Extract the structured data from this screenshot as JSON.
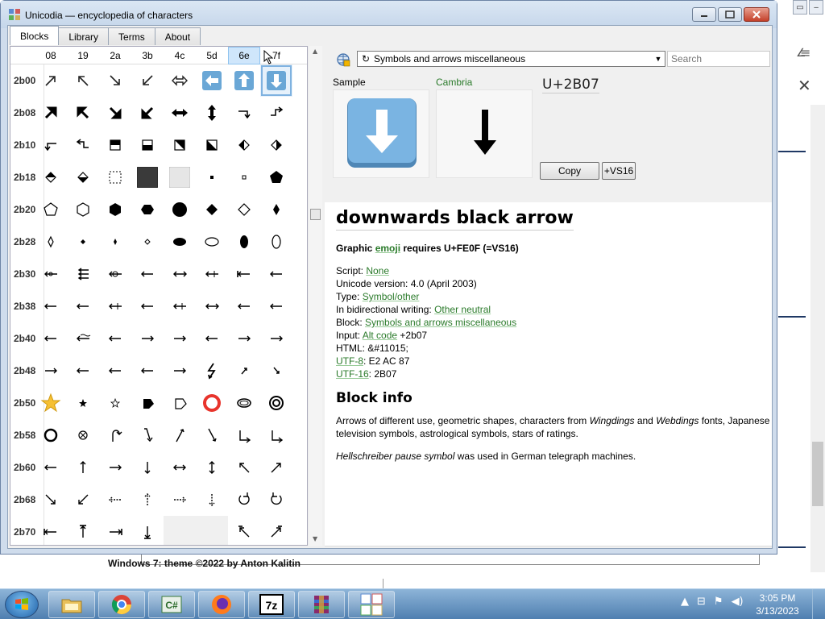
{
  "app": {
    "title": "Unicodia — encyclopedia of characters"
  },
  "tabs": [
    {
      "label": "Blocks",
      "active": true
    },
    {
      "label": "Library",
      "active": false
    },
    {
      "label": "Terms",
      "active": false
    },
    {
      "label": "About",
      "active": false
    }
  ],
  "grid": {
    "columns": [
      "08",
      "19",
      "2a",
      "3b",
      "4c",
      "5d",
      "6e",
      "7f"
    ],
    "highlighted_column": "6e",
    "selected_cell": {
      "row": "2b00",
      "col": 7
    },
    "rows": [
      {
        "label": "2b00",
        "cells": [
          "arrow-ne-outline",
          "arrow-nw-outline",
          "arrow-se-outline",
          "arrow-sw-outline",
          "arrow-lr-outline",
          "emoji-left",
          "emoji-up",
          "emoji-down"
        ]
      },
      {
        "label": "2b08",
        "cells": [
          "arrow-ne-black",
          "arrow-nw-black",
          "arrow-se-black",
          "arrow-sw-black",
          "arrow-lr-black",
          "arrow-ud-black",
          "arrow-corner-right",
          "arrow-up-right"
        ]
      },
      {
        "label": "2b10",
        "cells": [
          "arrow-corner-left",
          "arrow-up-left",
          "square-top-half",
          "square-bottom-half",
          "square-diag-ur",
          "square-diag-ll",
          "diamond-left-half",
          "diamond-right-half"
        ]
      },
      {
        "label": "2b18",
        "cells": [
          "diamond-top-half",
          "diamond-bottom-half",
          "dotted-square",
          "emoji-black-square",
          "emoji-white-square",
          "small-black-square",
          "small-white-square",
          "black-pentagon"
        ]
      },
      {
        "label": "2b20",
        "cells": [
          "white-pentagon",
          "white-hexagon",
          "black-hexagon",
          "black-horiz-hexagon",
          "black-circle",
          "black-diamond",
          "white-diamond",
          "black-narrow-diamond"
        ]
      },
      {
        "label": "2b28",
        "cells": [
          "white-narrow-diamond",
          "small-black-diamond",
          "small-narrow-diamond",
          "small-white-diamond",
          "black-h-ellipse",
          "white-h-ellipse",
          "black-v-ellipse",
          "white-v-ellipse"
        ]
      },
      {
        "label": "2b30",
        "cells": [
          "arrow-small-circle",
          "arrow-three-branch",
          "arrow-circle-plus",
          "arrow-wave-left",
          "arrow-double-tail",
          "arrow-vstroke",
          "arrow-bar-left",
          "arrow-tail-left"
        ]
      },
      {
        "label": "2b38",
        "cells": [
          "arrow-dotted-left",
          "arrow-double-left",
          "arrow-double-vs",
          "arrow-tilde-left",
          "arrow-double-2vs",
          "arrow-double-tail-2",
          "arrow-x-left",
          "arrow-curve-left"
        ]
      },
      {
        "label": "2b40",
        "cells": [
          "arrow-equal-left",
          "arrow-tilde-approx",
          "arrow-less-left",
          "arrow-right-greater",
          "arrow-right-subset",
          "arrow-triple-left",
          "arrow-triple-right",
          "arrow-right-tilde"
        ]
      },
      {
        "label": "2b48",
        "cells": [
          "arrow-tilde-right",
          "arrow-approx-left",
          "arrow-approx-left-2",
          "arrow-less-left-2",
          "arrow-right-less",
          "zigzag-arrow",
          "arrow-small-ne",
          "arrow-small-se"
        ]
      },
      {
        "label": "2b50",
        "cells": [
          "emoji-star",
          "small-black-star",
          "small-white-star",
          "black-ne-pentagon",
          "white-ne-pentagon",
          "emoji-circle",
          "heavy-ellipse",
          "ring-circle"
        ]
      },
      {
        "label": "2b58",
        "cells": [
          "heavy-white-circle",
          "circle-x",
          "arrow-hook-up",
          "arrow-hook-down",
          "arrow-slant-ne",
          "arrow-slant-se",
          "arrow-triangle-right",
          "arrow-triangle-right-2"
        ]
      },
      {
        "label": "2b60",
        "cells": [
          "arrow-left-tri",
          "arrow-up-tri",
          "arrow-right-tri",
          "arrow-down-tri",
          "arrow-lr-tri",
          "arrow-ud-tri",
          "arrow-nw-tri",
          "arrow-ne-tri"
        ]
      },
      {
        "label": "2b68",
        "cells": [
          "arrow-se-tri",
          "arrow-sw-tri",
          "arrow-left-dashed",
          "arrow-up-dashed",
          "arrow-right-dashed",
          "arrow-down-dashed",
          "arrow-cw-circle",
          "arrow-ccw-circle"
        ]
      },
      {
        "label": "2b70",
        "cells": [
          "arrow-left-bar",
          "arrow-up-bar",
          "arrow-right-bar",
          "arrow-down-bar",
          "",
          "",
          "arrow-nw-bar",
          "arrow-ne-bar"
        ]
      }
    ]
  },
  "toolbar": {
    "block_selected": "Symbols and arrows miscellaneous",
    "search_placeholder": "Search"
  },
  "sample": {
    "sample_label": "Sample",
    "font_label": "Cambria",
    "codepoint": "U+2B07",
    "copy_label": "Copy",
    "vs16_label": "+VS16"
  },
  "info": {
    "char_name": "downwards black arrow",
    "emoji_pre": "Graphic ",
    "emoji_link": "emoji",
    "emoji_post": " requires U+FE0F (=VS16)",
    "script_label": "Script: ",
    "script_value": "None",
    "version_text": "Unicode version: 4.0 (April 2003)",
    "type_label": "Type: ",
    "type_value": "Symbol/other",
    "bidi_label": "In bidirectional writing: ",
    "bidi_value": "Other neutral",
    "block_label": "Block: ",
    "block_value": "Symbols and arrows miscellaneous",
    "input_label": "Input: ",
    "input_link": "Alt code",
    "input_value": " +2b07",
    "html_text": "HTML: &#11015;",
    "utf8_link": "UTF-8",
    "utf8_value": ": E2 AC 87",
    "utf16_link": "UTF-16",
    "utf16_value": ": 2B07",
    "block_info_heading": "Block info",
    "block_desc_1": "Arrows of different use, geometric shapes, characters from ",
    "block_desc_w1": "Wingdings",
    "block_desc_and": " and ",
    "block_desc_w2": "Webdings",
    "block_desc_2": " fonts, Japanese television symbols, astrological symbols, stars of ratings.",
    "block_desc_it": "Hellschreiber pause symbol",
    "block_desc_3": " was used in German telegraph machines."
  },
  "background": {
    "text": "Windows 7: theme ©2022 by Anton Kalitin"
  },
  "taskbar": {
    "apps": [
      "explorer",
      "chrome",
      "csharp",
      "firefox",
      "7zip",
      "winrar",
      "unicodia"
    ],
    "time": "3:05 PM",
    "date": "3/13/2023"
  },
  "colors": {
    "link": "#2a7a2a",
    "emoji_blue": "#6aa7d6",
    "highlight": "#cfe6fb",
    "stop_red": "#e8342c",
    "star": "#f6c033"
  }
}
